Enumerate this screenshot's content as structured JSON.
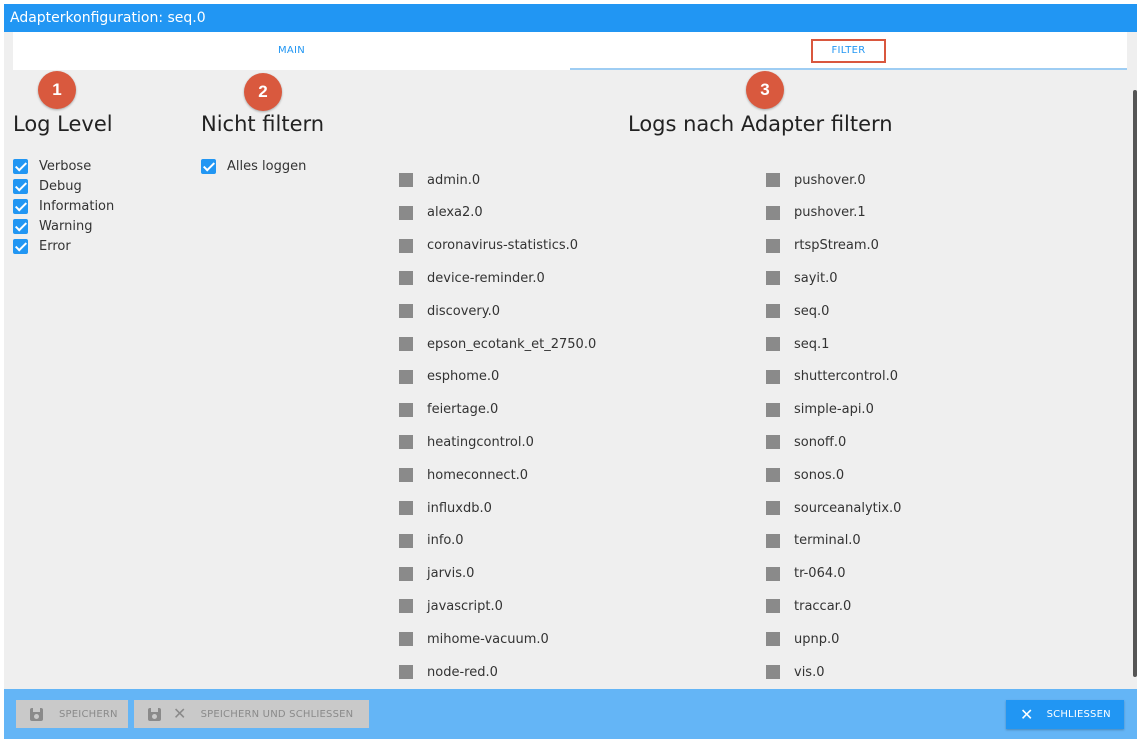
{
  "window": {
    "title": "Adapterkonfiguration: seq.0"
  },
  "tabs": [
    {
      "label": "MAIN",
      "active": false
    },
    {
      "label": "FILTER",
      "active": true
    }
  ],
  "badges": [
    "1",
    "2",
    "3"
  ],
  "sections": {
    "log_level": {
      "heading": "Log Level",
      "items": [
        {
          "label": "Verbose",
          "checked": true
        },
        {
          "label": "Debug",
          "checked": true
        },
        {
          "label": "Information",
          "checked": true
        },
        {
          "label": "Warning",
          "checked": true
        },
        {
          "label": "Error",
          "checked": true
        }
      ]
    },
    "no_filter": {
      "heading": "Nicht filtern",
      "items": [
        {
          "label": "Alles loggen",
          "checked": true
        }
      ]
    },
    "adapter_filter": {
      "heading": "Logs nach Adapter filtern",
      "left": [
        "admin.0",
        "alexa2.0",
        "coronavirus-statistics.0",
        "device-reminder.0",
        "discovery.0",
        "epson_ecotank_et_2750.0",
        "esphome.0",
        "feiertage.0",
        "heatingcontrol.0",
        "homeconnect.0",
        "influxdb.0",
        "info.0",
        "jarvis.0",
        "javascript.0",
        "mihome-vacuum.0",
        "node-red.0"
      ],
      "right": [
        "pushover.0",
        "pushover.1",
        "rtspStream.0",
        "sayit.0",
        "seq.0",
        "seq.1",
        "shuttercontrol.0",
        "simple-api.0",
        "sonoff.0",
        "sonos.0",
        "sourceanalytix.0",
        "terminal.0",
        "tr-064.0",
        "traccar.0",
        "upnp.0",
        "vis.0"
      ]
    }
  },
  "footer": {
    "save": "SPEICHERN",
    "save_close": "SPEICHERN UND SCHLIESSEN",
    "close": "SCHLIESSEN"
  },
  "colors": {
    "accent": "#2196f3",
    "badge": "#d9593e",
    "footer": "#64b5f6"
  }
}
